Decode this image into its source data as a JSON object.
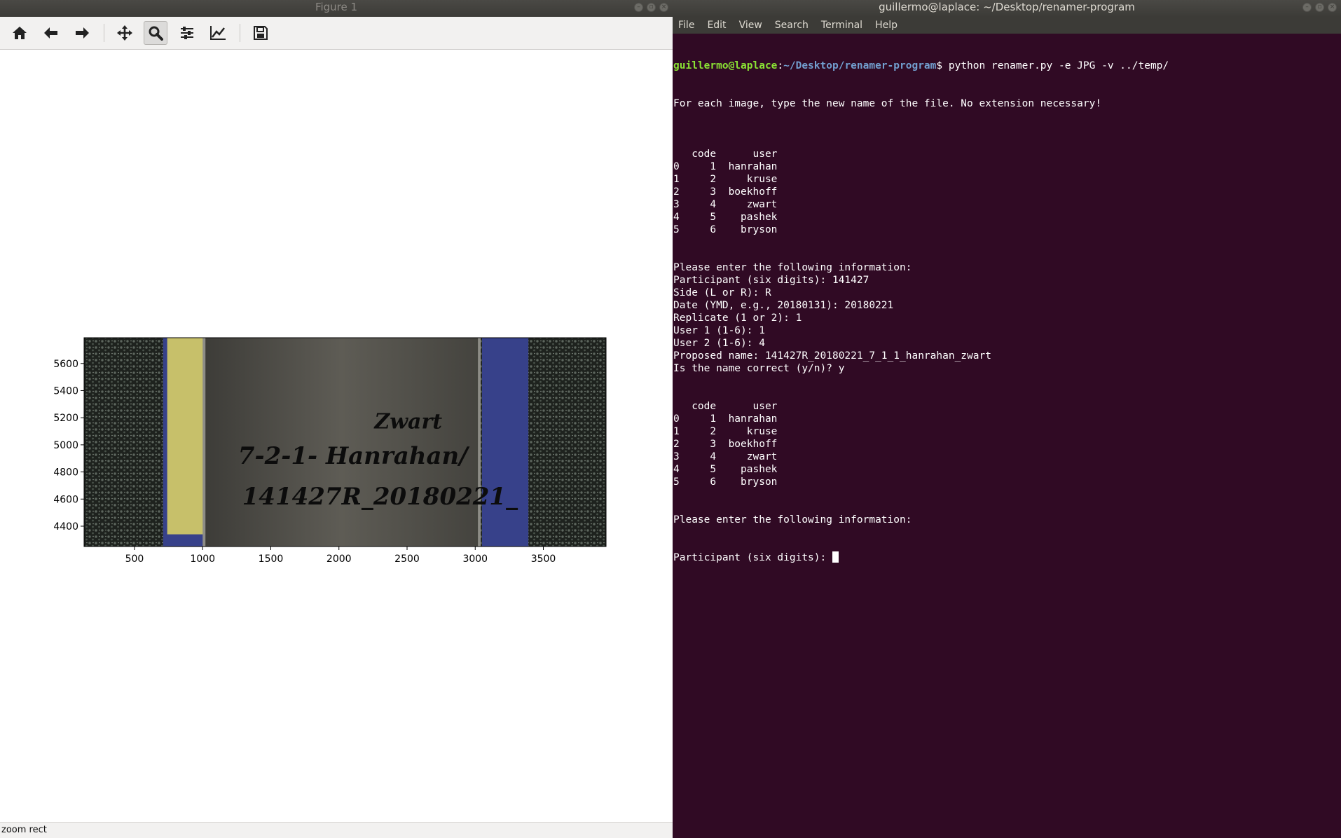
{
  "figure_window": {
    "title": "Figure 1",
    "toolbar": {
      "home": "home-icon",
      "back": "back-arrow-icon",
      "forward": "forward-arrow-icon",
      "pan": "pan-icon",
      "zoom": "zoom-icon",
      "configure": "configure-subplots-icon",
      "edit": "edit-axis-icon",
      "save": "save-icon",
      "active_tool": "zoom"
    },
    "status": "zoom rect"
  },
  "plot": {
    "xticks": [
      "500",
      "1000",
      "1500",
      "2000",
      "2500",
      "3000",
      "3500"
    ],
    "yticks": [
      "4400",
      "4600",
      "4800",
      "5000",
      "5200",
      "5400",
      "5600"
    ],
    "xlim": [
      130,
      3960
    ],
    "ylim": [
      5790,
      4250
    ],
    "image_text": {
      "line1": "141427R_20180221_",
      "line2": "7-2-1- Hanrahan/",
      "line3": "Zwart"
    },
    "colors": {
      "carpet": "#1f231f",
      "blue_cloth": "#37418a",
      "paper": "#55534d",
      "tape": "#c7c06a"
    }
  },
  "terminal": {
    "title": "guillermo@laplace: ~/Desktop/renamer-program",
    "menu": [
      "File",
      "Edit",
      "View",
      "Search",
      "Terminal",
      "Help"
    ],
    "prompt_user": "guillermo@laplace",
    "prompt_sep": ":",
    "prompt_path": "~/Desktop/renamer-program",
    "prompt_end": "$ ",
    "command": "python renamer.py -e JPG -v ../temp/",
    "lines": [
      "For each image, type the new name of the file. No extension necessary!",
      "",
      "",
      "",
      "   code      user",
      "0     1  hanrahan",
      "1     2     kruse",
      "2     3  boekhoff",
      "3     4     zwart",
      "4     5    pashek",
      "5     6    bryson",
      "",
      "",
      "Please enter the following information:",
      "Participant (six digits): 141427",
      "Side (L or R): R",
      "Date (YMD, e.g., 20180131): 20180221",
      "Replicate (1 or 2): 1",
      "User 1 (1-6): 1",
      "User 2 (1-6): 4",
      "Proposed name: 141427R_20180221_7_1_1_hanrahan_zwart",
      "Is the name correct (y/n)? y",
      "",
      "",
      "   code      user",
      "0     1  hanrahan",
      "1     2     kruse",
      "2     3  boekhoff",
      "3     4     zwart",
      "4     5    pashek",
      "5     6    bryson",
      "",
      "",
      "Please enter the following information:"
    ],
    "current_input_prompt": "Participant (six digits): "
  }
}
